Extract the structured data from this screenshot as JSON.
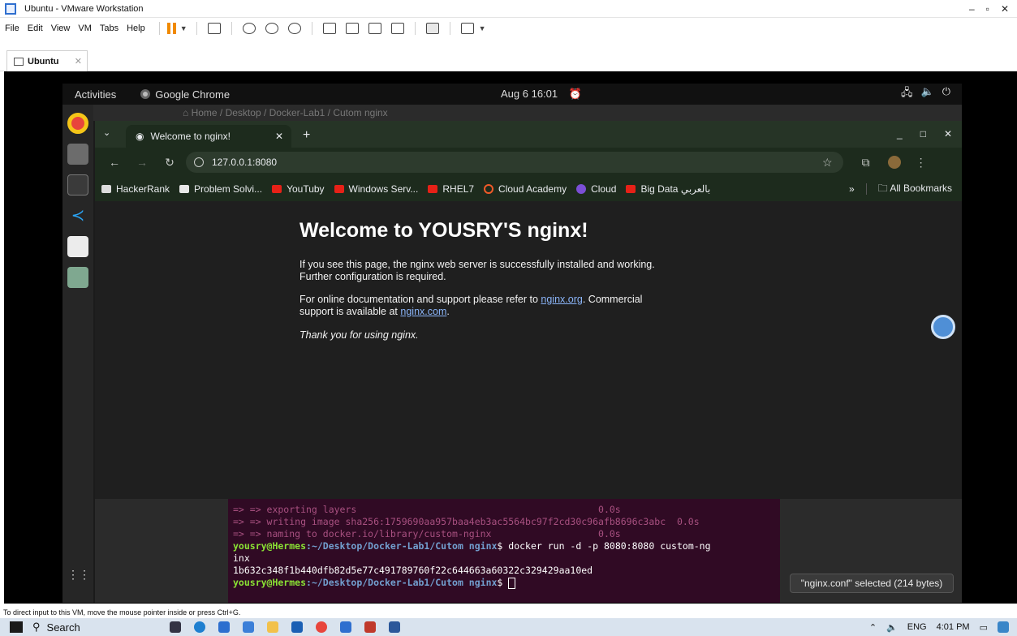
{
  "vmware": {
    "title": "Ubuntu - VMware Workstation",
    "menu": [
      "File",
      "Edit",
      "View",
      "VM",
      "Tabs",
      "Help"
    ],
    "tab_label": "Ubuntu",
    "status_text": "To direct input to this VM, move the mouse pointer inside or press Ctrl+G."
  },
  "gnome": {
    "activities": "Activities",
    "app_name": "Google Chrome",
    "clock": "Aug 6  16:01"
  },
  "files_bg": {
    "path_text": "⌂ Home  /  Desktop  /  Docker-Lab1  /  Cutom nginx"
  },
  "chrome": {
    "tab_title": "Welcome to nginx!",
    "url": "127.0.0.1:8080",
    "bookmarks": [
      {
        "label": "HackerRank",
        "color": "#1f1f1f"
      },
      {
        "label": "Problem Solvi...",
        "color": "#444444"
      },
      {
        "label": "YouTuby",
        "color": "#e62117"
      },
      {
        "label": "Windows Serv...",
        "color": "#e62117"
      },
      {
        "label": "RHEL7",
        "color": "#e62117"
      },
      {
        "label": "Cloud Academy",
        "color": "#f05a28"
      },
      {
        "label": "Cloud",
        "color": "#7b4fd6"
      },
      {
        "label": "Big Data بالعربي",
        "color": "#e62117"
      }
    ],
    "all_bookmarks": "All Bookmarks"
  },
  "page": {
    "heading": "Welcome to YOUSRY'S nginx!",
    "p1": "If you see this page, the nginx web server is successfully installed and working. Further configuration is required.",
    "p2_before": "For online documentation and support please refer to ",
    "link1": "nginx.org",
    "p2_mid": ". Commercial support is available at ",
    "link2": "nginx.com",
    "p2_after": ".",
    "p3": "Thank you for using nginx."
  },
  "terminal": {
    "line1": "=> => exporting layers                                           0.0s",
    "line2": "=> => writing image sha256:1759690aa957baa4eb3ac5564bc97f2cd30c96afb8696c3abc  0.0s",
    "line3": "=> => naming to docker.io/library/custom-nginx                   0.0s",
    "prompt_user": "yousry@Hermes",
    "prompt_path": ":~/Desktop/Docker-Lab1/Cutom nginx",
    "command": "$ docker run -d -p 8080:8080 custom-ng",
    "command_wrap": "inx",
    "output": "1b632c348f1b440dfb82d5e77c491789760f22c644663a60322c329429aa10ed",
    "prompt2_path": ":~/Desktop/Docker-Lab1/Cutom nginx",
    "prompt2_end": "$ "
  },
  "nautilus_status": "\"nginx.conf\" selected  (214 bytes)",
  "taskbar": {
    "search": "Search",
    "lang": "ENG",
    "time": "4:01 PM"
  }
}
